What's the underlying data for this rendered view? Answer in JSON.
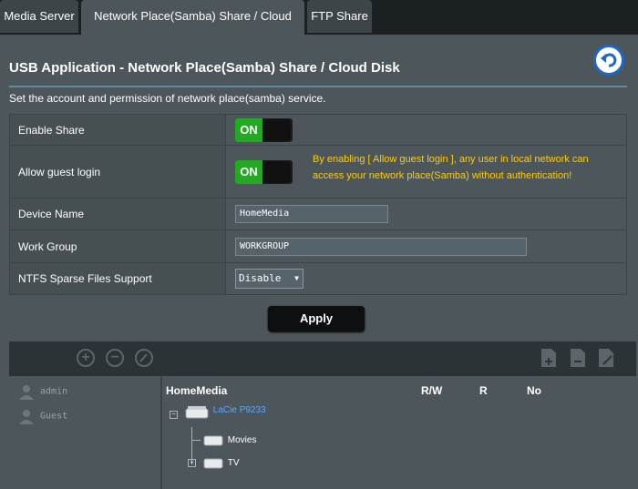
{
  "tabs": [
    {
      "label": "Media Server",
      "active": false
    },
    {
      "label": "Network Place(Samba) Share / Cloud Disk",
      "active": true
    },
    {
      "label": "FTP Share",
      "active": false
    }
  ],
  "page": {
    "title": "USB Application - Network Place(Samba) Share / Cloud Disk",
    "description": "Set the account and permission of network place(samba) service."
  },
  "settings": {
    "enable_share": {
      "label": "Enable Share",
      "state": "ON"
    },
    "guest_login": {
      "label": "Allow guest login",
      "state": "ON",
      "note": "By enabling [ Allow guest login ], any user in local network can access your network place(Samba) without authentication!"
    },
    "device_name": {
      "label": "Device Name",
      "value": "HomeMedia"
    },
    "work_group": {
      "label": "Work Group",
      "value": "WORKGROUP"
    },
    "ntfs_sparse": {
      "label": "NTFS Sparse Files Support",
      "value": "Disable"
    }
  },
  "apply_label": "Apply",
  "accounts": {
    "users": [
      "admin",
      "Guest"
    ]
  },
  "folders": {
    "root": "HomeMedia",
    "columns": {
      "rw": "R/W",
      "r": "R",
      "no": "No"
    },
    "drive": "LaCie P9233",
    "subfolders": [
      "Movies",
      "TV"
    ]
  },
  "colors": {
    "accent": "#1c67c9",
    "toggle_on": "#22aa22",
    "warning": "#ffcc00",
    "drive_link": "#5aa9ff"
  }
}
